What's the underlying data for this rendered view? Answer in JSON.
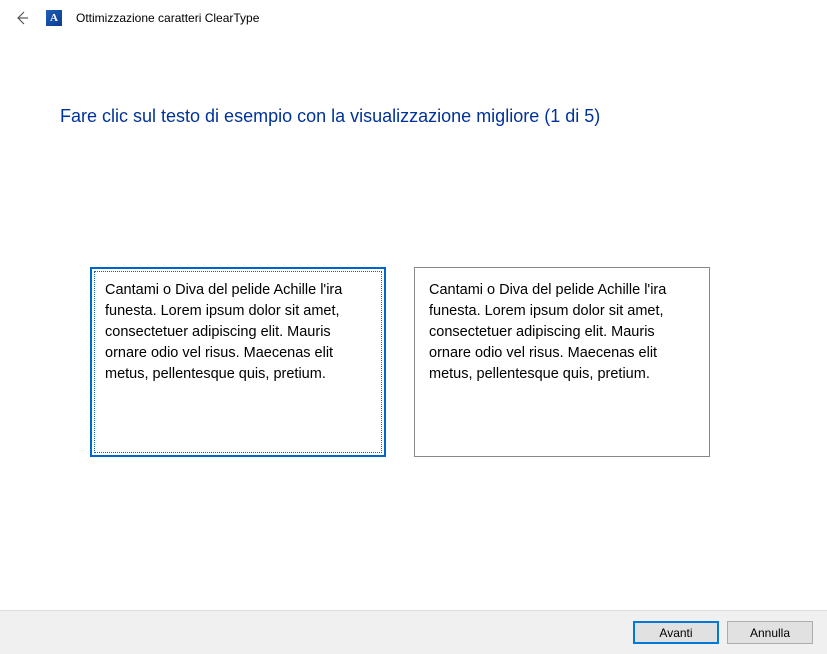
{
  "header": {
    "title": "Ottimizzazione caratteri ClearType",
    "icon_letter": "A"
  },
  "main": {
    "instruction": "Fare clic sul testo di esempio con la visualizzazione migliore (1 di 5)",
    "sample_text": "Cantami o Diva del pelide Achille l'ira funesta. Lorem ipsum dolor sit amet, consectetuer adipiscing elit. Mauris ornare odio vel risus. Maecenas elit metus, pellentesque quis, pretium.",
    "samples": [
      {
        "selected": true
      },
      {
        "selected": false
      }
    ]
  },
  "footer": {
    "next_label": "Avanti",
    "cancel_label": "Annulla"
  }
}
